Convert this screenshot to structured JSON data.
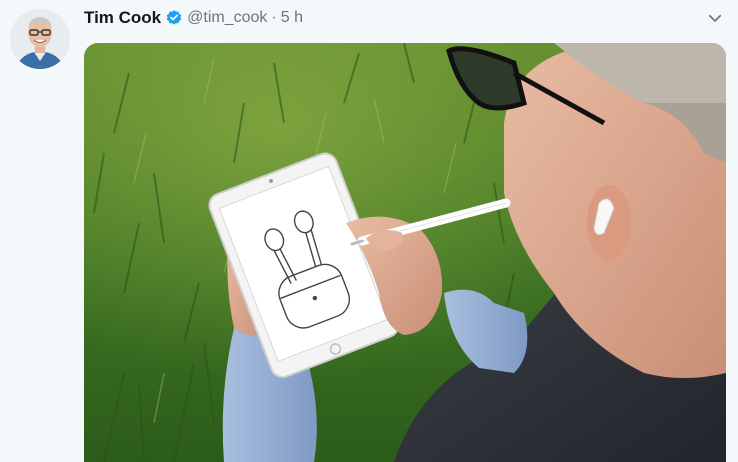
{
  "tweet": {
    "author_name": "Tim Cook",
    "handle": "@tim_cook",
    "separator": "·",
    "timestamp": "5 h"
  },
  "icons": {
    "verified": "verified-badge-icon",
    "caret": "chevron-down-icon"
  },
  "colors": {
    "verified_blue": "#1da1f2",
    "name_text": "#14171a",
    "secondary_text": "#657786",
    "background": "#f5f8fa"
  }
}
